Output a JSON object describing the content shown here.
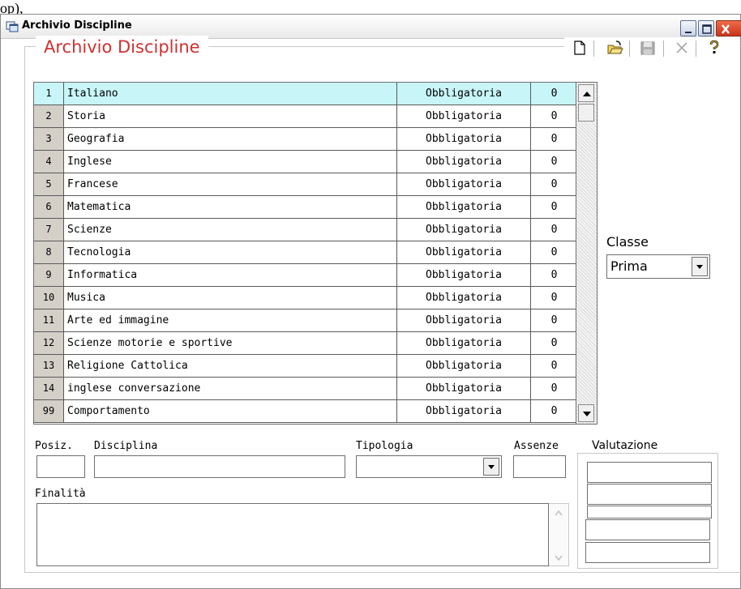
{
  "background_text": {
    "left": "op",
    "highlight": "",
    "right": "), "
  },
  "window": {
    "title": "Archivio Discipline"
  },
  "group": {
    "title": "Archivio Discipline"
  },
  "toolbar": {
    "icons": [
      "new-document-icon",
      "open-folder-icon",
      "save-disk-icon",
      "delete-x-icon",
      "help-question-icon"
    ]
  },
  "table": {
    "rows": [
      {
        "idx": "1",
        "name": "Italiano",
        "type": "Obbligatoria",
        "abs": "0"
      },
      {
        "idx": "2",
        "name": "Storia",
        "type": "Obbligatoria",
        "abs": "0"
      },
      {
        "idx": "3",
        "name": "Geografia",
        "type": "Obbligatoria",
        "abs": "0"
      },
      {
        "idx": "4",
        "name": "Inglese",
        "type": "Obbligatoria",
        "abs": "0"
      },
      {
        "idx": "5",
        "name": "Francese",
        "type": "Obbligatoria",
        "abs": "0"
      },
      {
        "idx": "6",
        "name": "Matematica",
        "type": "Obbligatoria",
        "abs": "0"
      },
      {
        "idx": "7",
        "name": "Scienze",
        "type": "Obbligatoria",
        "abs": "0"
      },
      {
        "idx": "8",
        "name": "Tecnologia",
        "type": "Obbligatoria",
        "abs": "0"
      },
      {
        "idx": "9",
        "name": "Informatica",
        "type": "Obbligatoria",
        "abs": "0"
      },
      {
        "idx": "10",
        "name": "Musica",
        "type": "Obbligatoria",
        "abs": "0"
      },
      {
        "idx": "11",
        "name": "Arte ed immagine",
        "type": "Obbligatoria",
        "abs": "0"
      },
      {
        "idx": "12",
        "name": "Scienze motorie e sportive",
        "type": "Obbligatoria",
        "abs": "0"
      },
      {
        "idx": "13",
        "name": "Religione Cattolica",
        "type": "Obbligatoria",
        "abs": "0"
      },
      {
        "idx": "14",
        "name": "inglese conversazione",
        "type": "Obbligatoria",
        "abs": "0"
      },
      {
        "idx": "99",
        "name": "Comportamento",
        "type": "Obbligatoria",
        "abs": "0"
      }
    ],
    "selected_index": 0
  },
  "classe": {
    "label": "Classe",
    "value": "Prima"
  },
  "form": {
    "posiz_label": "Posiz.",
    "disciplina_label": "Disciplina",
    "tipologia_label": "Tipologia",
    "assenze_label": "Assenze",
    "finalita_label": "Finalità",
    "valutazione_label": "Valutazione",
    "valutazione_fields": 5
  },
  "colors": {
    "group_title": "#d03030",
    "selected_row": "#c8f5f8",
    "index_column": "#d4d0c8",
    "highlight": "#ffff33"
  }
}
